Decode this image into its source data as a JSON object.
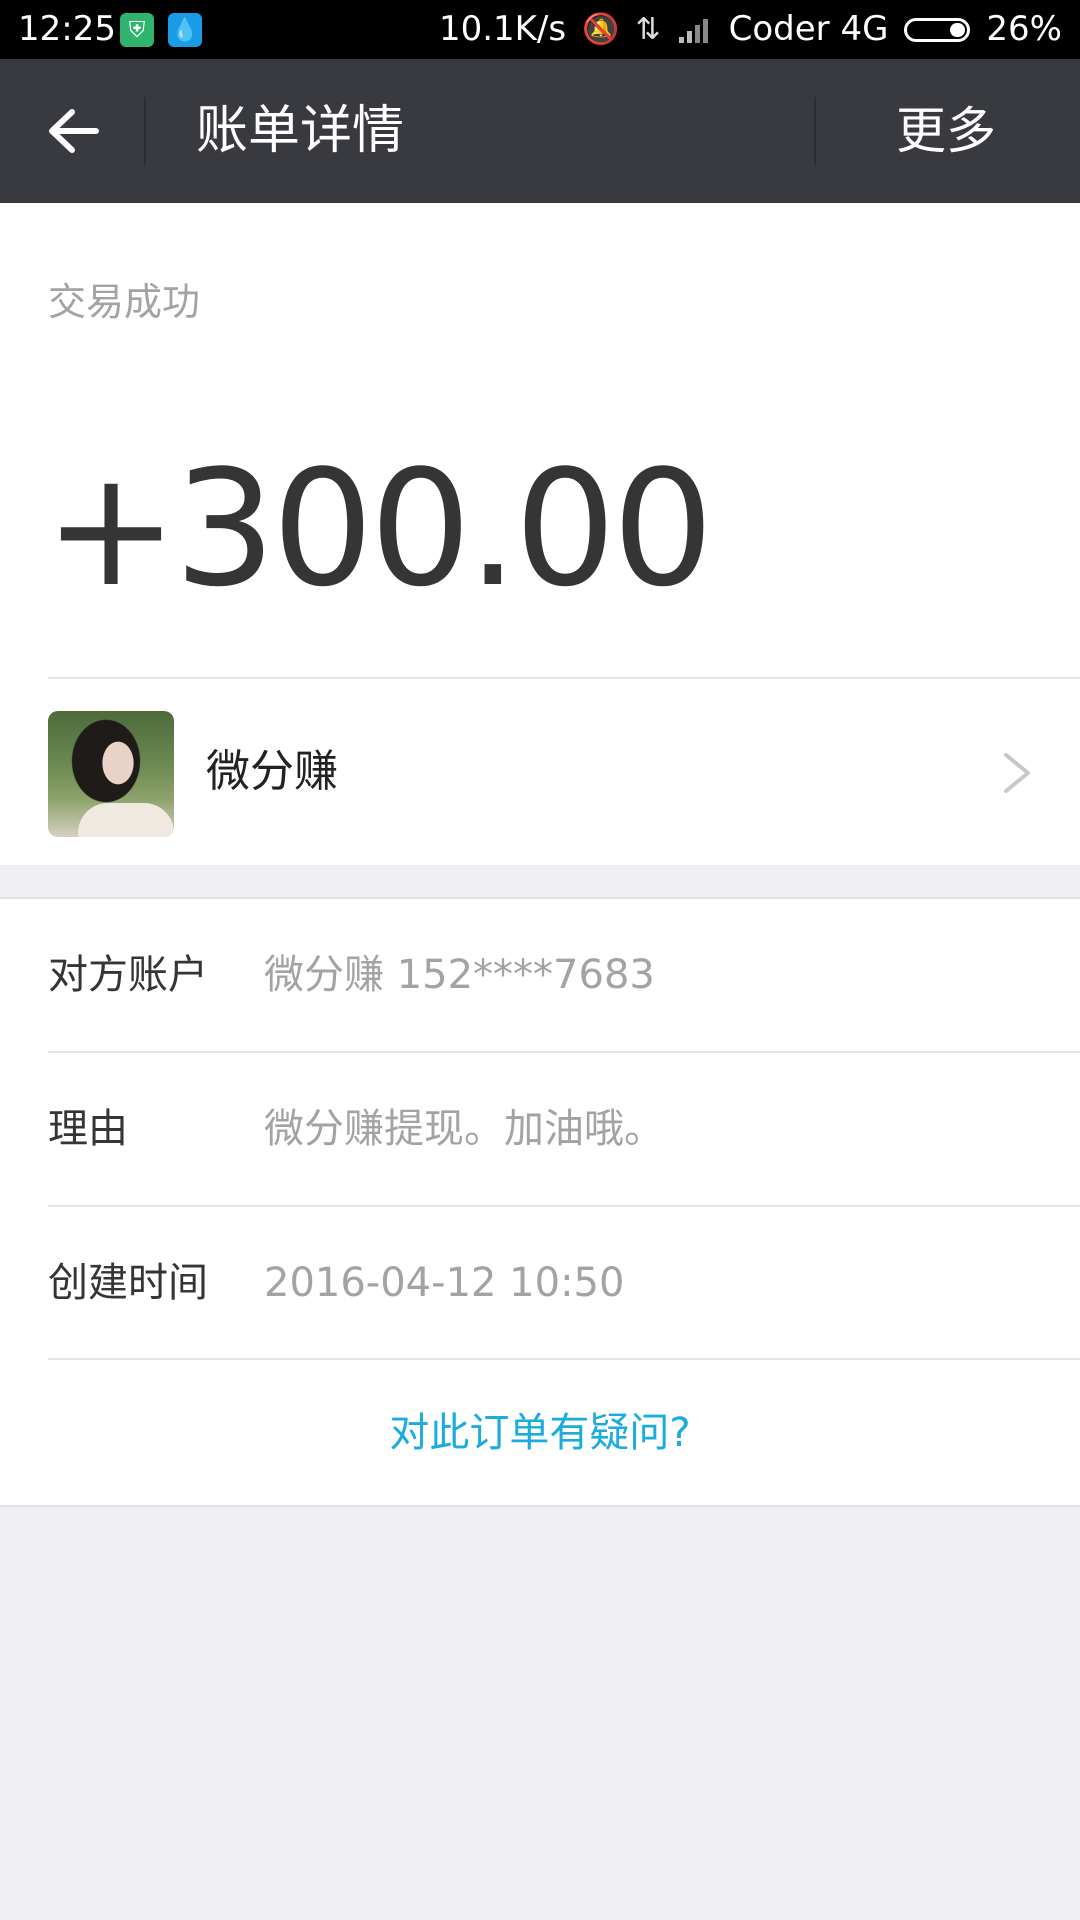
{
  "status_bar": {
    "time": "12:25",
    "net_speed": "10.1K/s",
    "carrier": "Coder 4G",
    "battery": "26%",
    "battery_level": 0.26
  },
  "nav": {
    "title": "账单详情",
    "more": "更多"
  },
  "transaction": {
    "status": "交易成功",
    "amount": "+300.00",
    "payer_name": "微分赚"
  },
  "details": [
    {
      "label": "对方账户",
      "value": "微分赚 152****7683"
    },
    {
      "label": "理由",
      "value": "微分赚提现。加油哦。"
    },
    {
      "label": "创建时间",
      "value": "2016-04-12 10:50"
    }
  ],
  "question_link": "对此订单有疑问?",
  "icons": [
    "back-arrow-icon",
    "chevron-right-icon",
    "shield-icon",
    "water-drop-icon",
    "mute-icon",
    "data-arrows-icon",
    "signal-icon",
    "battery-icon"
  ]
}
